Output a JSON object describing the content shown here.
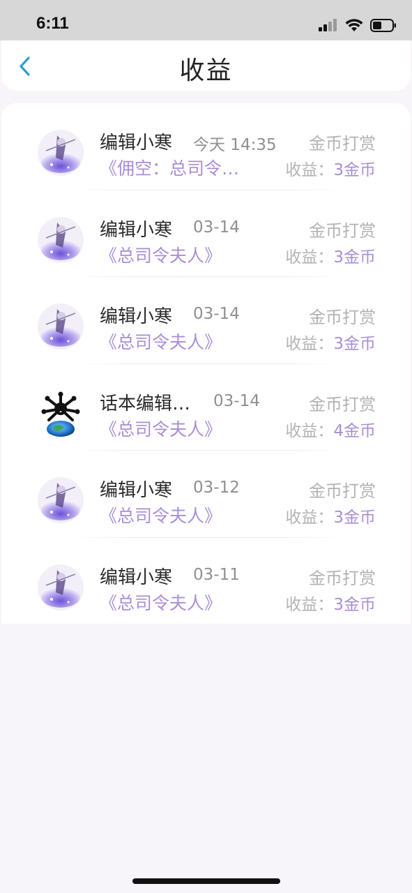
{
  "status_bar": {
    "time": "6:11"
  },
  "header": {
    "title": "收益"
  },
  "records": [
    {
      "name": "编辑小寒",
      "date": "今天 14:35",
      "type": "金币打赏",
      "book": "《佣空：总司令…",
      "earn_label": "收益：",
      "earn_value": "3金币",
      "avatar": "anime-girl-avatar"
    },
    {
      "name": "编辑小寒",
      "date": "03-14",
      "type": "金币打赏",
      "book": "《总司令夫人》",
      "earn_label": "收益：",
      "earn_value": "3金币",
      "avatar": "anime-girl-avatar"
    },
    {
      "name": "编辑小寒",
      "date": "03-14",
      "type": "金币打赏",
      "book": "《总司令夫人》",
      "earn_label": "收益：",
      "earn_value": "3金币",
      "avatar": "anime-girl-avatar"
    },
    {
      "name": "话本编辑…",
      "date": "03-14",
      "type": "金币打赏",
      "book": "《总司令夫人》",
      "earn_label": "收益：",
      "earn_value": "4金币",
      "avatar": "globe-mascot-avatar"
    },
    {
      "name": "编辑小寒",
      "date": "03-12",
      "type": "金币打赏",
      "book": "《总司令夫人》",
      "earn_label": "收益：",
      "earn_value": "3金币",
      "avatar": "anime-girl-avatar"
    },
    {
      "name": "编辑小寒",
      "date": "03-11",
      "type": "金币打赏",
      "book": "《总司令夫人》",
      "earn_label": "收益：",
      "earn_value": "3金币",
      "avatar": "anime-girl-avatar"
    }
  ],
  "colors": {
    "accent": "#a98ed6",
    "back_arrow": "#2a9fd6",
    "muted": "#b3b3b3"
  }
}
